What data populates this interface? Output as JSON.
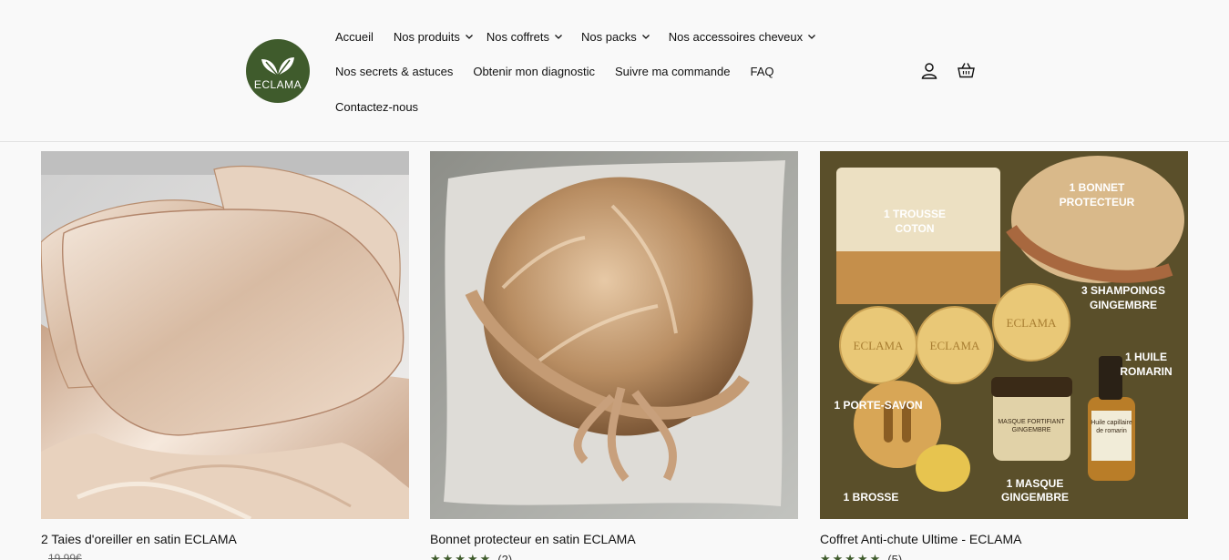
{
  "header": {
    "logo_text": "ECLAMA",
    "nav_row1": [
      {
        "label": "Accueil",
        "dropdown": false
      },
      {
        "label": "Nos produits",
        "dropdown": true
      },
      {
        "label": "Nos coffrets",
        "dropdown": true
      },
      {
        "label": "Nos packs",
        "dropdown": true
      },
      {
        "label": "Nos accessoires cheveux",
        "dropdown": true
      }
    ],
    "nav_row2": [
      {
        "label": "Nos secrets & astuces"
      },
      {
        "label": "Obtenir mon diagnostic"
      },
      {
        "label": "Suivre ma commande"
      },
      {
        "label": "FAQ"
      }
    ],
    "nav_row3": [
      {
        "label": "Contactez-nous"
      }
    ],
    "icons": [
      "user-icon",
      "basket-icon"
    ]
  },
  "products": [
    {
      "title": "2 Taies d'oreiller en satin ECLAMA",
      "old_price": "19,99€",
      "image": "satin-pillowcases"
    },
    {
      "title": "Bonnet protecteur en satin ECLAMA",
      "stars": "★★★★★",
      "reviews": "(2)",
      "image": "satin-bonnet"
    },
    {
      "title": "Coffret Anti-chute Ultime - ECLAMA",
      "stars": "★★★★★",
      "reviews": "(5)",
      "image": "coffret-antichute",
      "image_labels": {
        "trousse": [
          "1 TROUSSE",
          "COTON"
        ],
        "bonnet": [
          "1 BONNET",
          "PROTECTEUR"
        ],
        "shampoings": [
          "3 SHAMPOINGS",
          "GINGEMBRE"
        ],
        "huile": [
          "1 HUILE",
          "ROMARIN"
        ],
        "porte_savon": "1 PORTE-SAVON",
        "brosse": "1 BROSSE",
        "masque": [
          "1 MASQUE",
          "GINGEMBRE"
        ],
        "soap_brand": "ECLAMA",
        "jar_label": [
          "MASQUE FORTIFIANT",
          "GINGEMBRE"
        ],
        "bottle_label": [
          "Huile capillaire",
          "de romarin"
        ]
      }
    }
  ]
}
